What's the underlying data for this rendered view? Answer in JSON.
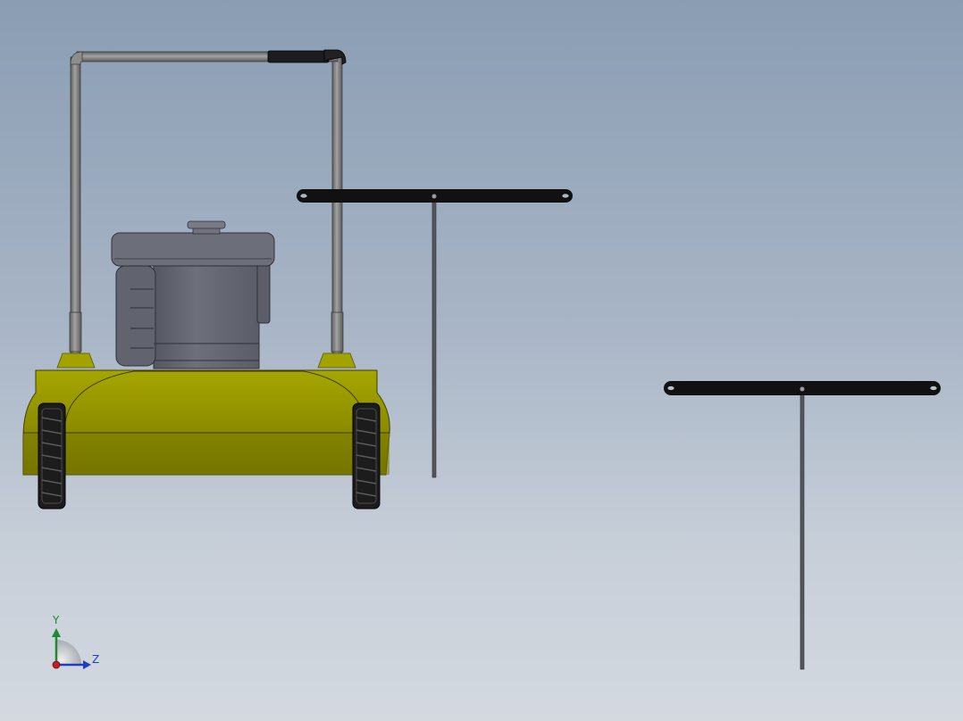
{
  "view": {
    "background_top": "#8a9db3",
    "background_bottom": "#d4d9e0"
  },
  "model": {
    "parts": [
      "mower-body",
      "engine",
      "handle",
      "wheels",
      "t-bar-part"
    ],
    "colors": {
      "deck": "#9a9a00",
      "deck_dark": "#707000",
      "engine": "#6a6d78",
      "handle": "#8c8c8c",
      "grip": "#1a1a1a",
      "t_bar": "#111111",
      "t_stem": "#56565e"
    }
  },
  "triad": {
    "y_label": "Y",
    "z_label": "Z",
    "y_color": "#1e8a2e",
    "z_color": "#1e3fbf",
    "x_color": "#c0202a"
  }
}
